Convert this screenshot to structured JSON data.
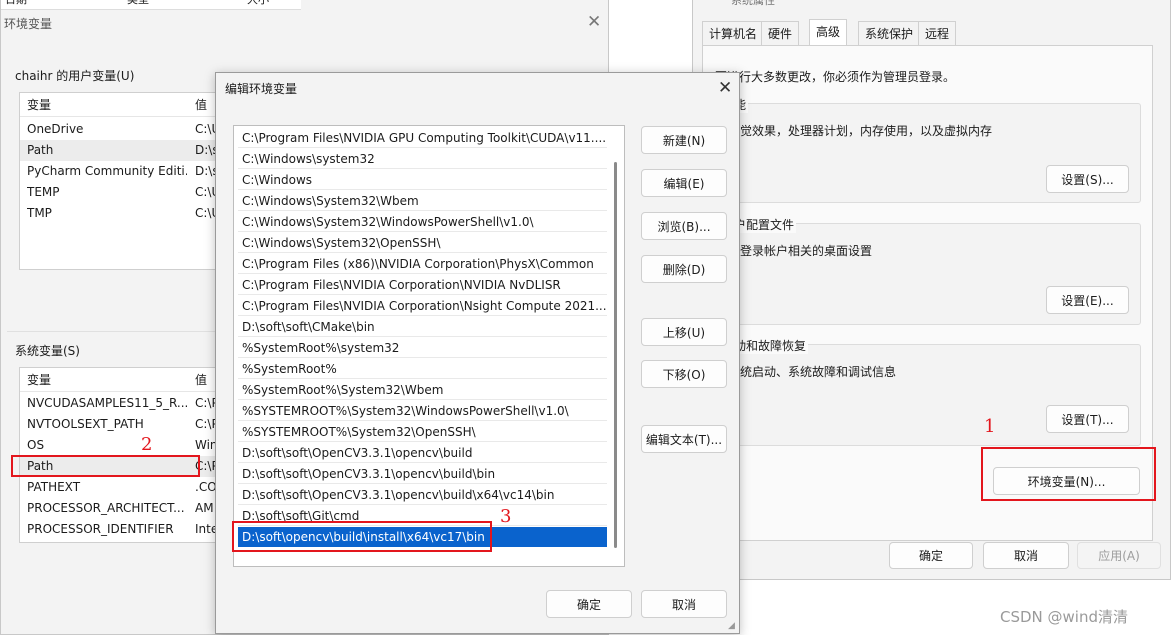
{
  "env_window": {
    "title": "环境变量",
    "top_cols": [
      "日期",
      "类型",
      "大小"
    ],
    "user_vars_label": "chaihr 的用户变量(U)",
    "user_table": {
      "headers": [
        "变量",
        "值"
      ],
      "rows": [
        {
          "name": "OneDrive",
          "value": "C:\\U"
        },
        {
          "name": "Path",
          "value": "D:\\s"
        },
        {
          "name": "PyCharm Community Editi...",
          "value": "D:\\s"
        },
        {
          "name": "TEMP",
          "value": "C:\\U"
        },
        {
          "name": "TMP",
          "value": "C:\\U"
        }
      ]
    },
    "sys_vars_label": "系统变量(S)",
    "sys_table": {
      "headers": [
        "变量",
        "值"
      ],
      "rows": [
        {
          "name": "NVCUDASAMPLES11_5_R...",
          "value": "C:\\P"
        },
        {
          "name": "NVTOOLSEXT_PATH",
          "value": "C:\\P"
        },
        {
          "name": "OS",
          "value": "Win"
        },
        {
          "name": "Path",
          "value": "C:\\P"
        },
        {
          "name": "PATHEXT",
          "value": ".CO"
        },
        {
          "name": "PROCESSOR_ARCHITECT...",
          "value": "AM"
        },
        {
          "name": "PROCESSOR_IDENTIFIER",
          "value": "Inte"
        }
      ]
    }
  },
  "edit_dialog": {
    "title": "编辑环境变量",
    "paths": [
      "C:\\Program Files\\NVIDIA GPU Computing Toolkit\\CUDA\\v11....",
      "C:\\Windows\\system32",
      "C:\\Windows",
      "C:\\Windows\\System32\\Wbem",
      "C:\\Windows\\System32\\WindowsPowerShell\\v1.0\\",
      "C:\\Windows\\System32\\OpenSSH\\",
      "C:\\Program Files (x86)\\NVIDIA Corporation\\PhysX\\Common",
      "C:\\Program Files\\NVIDIA Corporation\\NVIDIA NvDLISR",
      "C:\\Program Files\\NVIDIA Corporation\\Nsight Compute 2021....",
      "D:\\soft\\soft\\CMake\\bin",
      "%SystemRoot%\\system32",
      "%SystemRoot%",
      "%SystemRoot%\\System32\\Wbem",
      "%SYSTEMROOT%\\System32\\WindowsPowerShell\\v1.0\\",
      "%SYSTEMROOT%\\System32\\OpenSSH\\",
      "D:\\soft\\soft\\OpenCV3.3.1\\opencv\\build",
      "D:\\soft\\soft\\OpenCV3.3.1\\opencv\\build\\bin",
      "D:\\soft\\soft\\OpenCV3.3.1\\opencv\\build\\x64\\vc14\\bin",
      "D:\\soft\\soft\\Git\\cmd",
      "D:\\soft\\opencv\\build\\install\\x64\\vc17\\bin"
    ],
    "selected_index": 19,
    "buttons": {
      "new": "新建(N)",
      "edit": "编辑(E)",
      "browse": "浏览(B)...",
      "delete": "删除(D)",
      "move_up": "上移(U)",
      "move_down": "下移(O)",
      "edit_text": "编辑文本(T)...",
      "ok": "确定",
      "cancel": "取消"
    }
  },
  "sysprops": {
    "title": "系统属性",
    "tabs": [
      "计算机名",
      "硬件",
      "高级",
      "系统保护",
      "远程"
    ],
    "active_tab": "高级",
    "admin_note": "要进行大多数更改，你必须作为管理员登录。",
    "perf": {
      "title": "性能",
      "desc": "视觉效果，处理器计划，内存使用，以及虚拟内存",
      "button": "设置(S)..."
    },
    "profile": {
      "title": "用户配置文件",
      "desc": "与登录帐户相关的桌面设置",
      "button": "设置(E)..."
    },
    "startup": {
      "title": "启动和故障恢复",
      "desc": "系统启动、系统故障和调试信息",
      "button": "设置(T)..."
    },
    "env_button": "环境变量(N)...",
    "ok": "确定",
    "cancel": "取消",
    "apply": "应用(A)"
  },
  "annotations": {
    "one": "1",
    "two": "2",
    "three": "3",
    "red": "#e3161d"
  },
  "watermark": "CSDN @wind清清"
}
